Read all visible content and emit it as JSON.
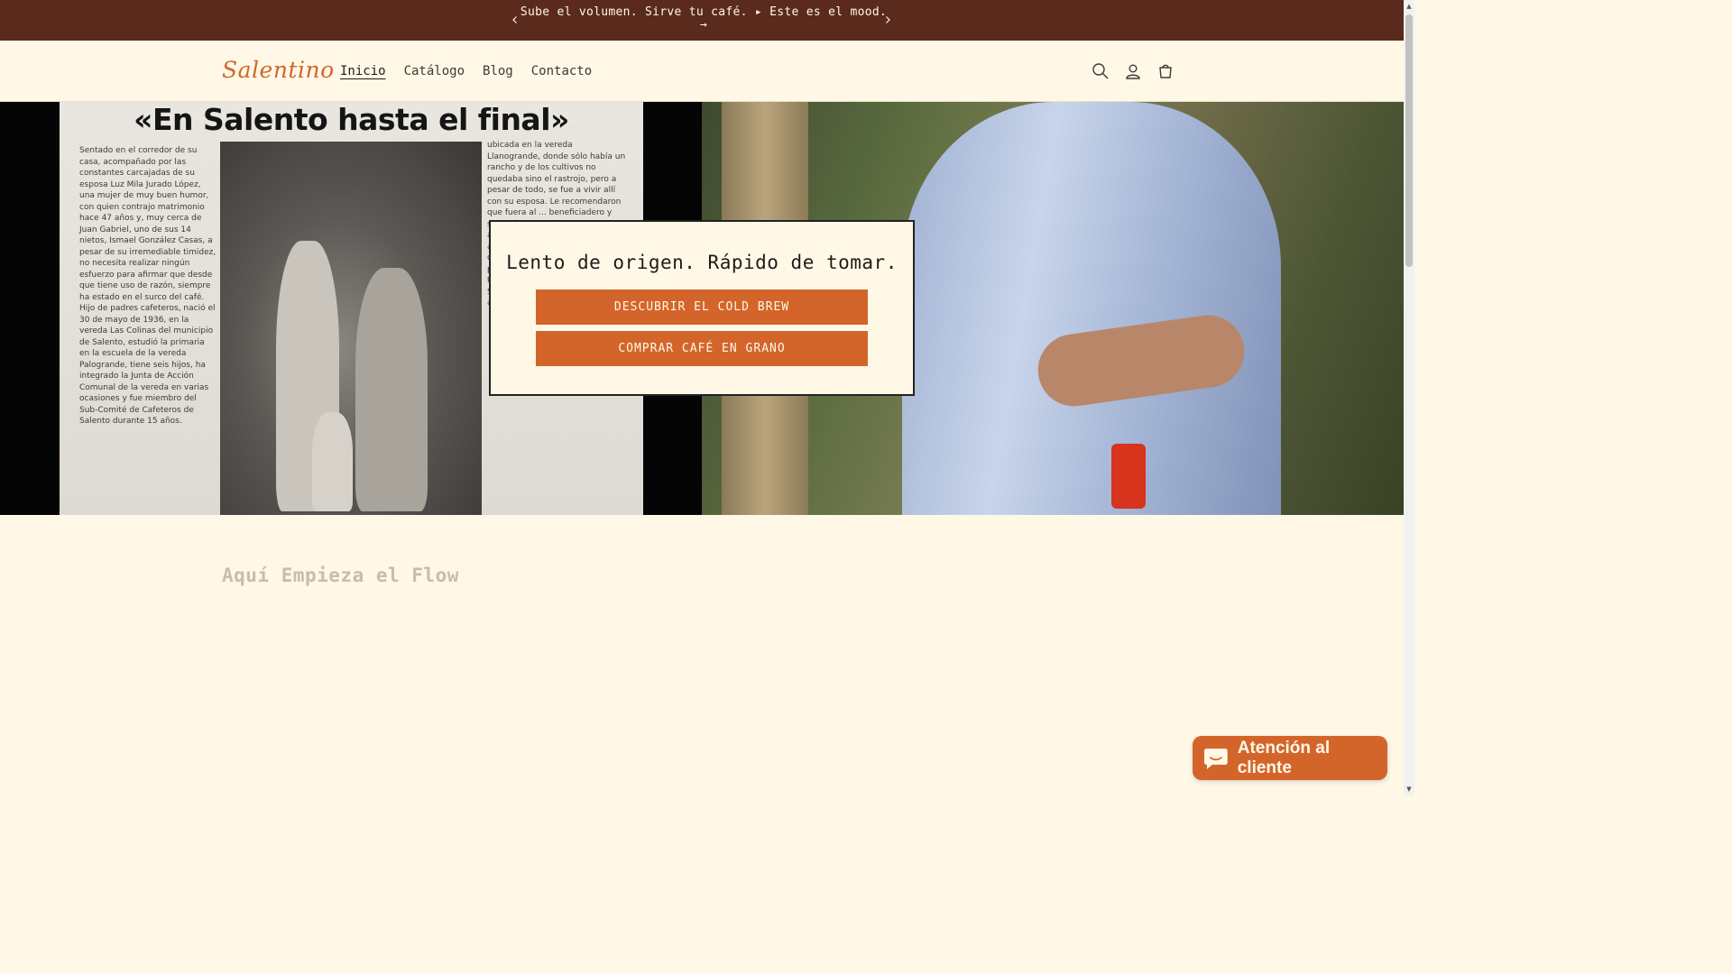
{
  "announcement": {
    "text": "Sube el volumen. Sirve tu café. ▸ Este es el mood.",
    "arrow": "→",
    "prev_icon": "chevron-left-icon",
    "next_icon": "chevron-right-icon"
  },
  "header": {
    "logo": "Salentino",
    "nav": [
      "Inicio",
      "Catálogo",
      "Blog",
      "Contacto"
    ],
    "active_nav": "Inicio",
    "icons": [
      "search-icon",
      "account-icon",
      "cart-icon"
    ]
  },
  "hero": {
    "newspaper_headline": "«En Salento hasta el final»",
    "newspaper_col1": "Sentado en el corredor de su casa, acompañado por las constantes carcajadas de su esposa Luz Mila Jurado López, una mujer de muy buen humor, con quien contrajo matrimonio hace 47 años y, muy cerca de Juan Gabriel, uno de sus 14 nietos, Ismael González Casas, a pesar de su irremediable timidez, no necesita realizar ningún esfuerzo para afirmar que desde que tiene uso de razón, siempre ha estado en el surco del café. Hijo de padres cafeteros, nació el 30 de mayo de 1936, en la vereda Las Colinas del municipio de Salento, estudió la primaria en la escuela de la vereda Palogrande, tiene seis hijos, ha integrado la Junta de Acción Comunal de la vereda en varias ocasiones y fue miembro del Sub-Comité de Cafeteros de Salento durante 15 años.",
    "newspaper_col2": "ubicada en la vereda Llanogrande, donde sólo había un rancho y de los cultivos no quedaba sino el rastrojo, pero a pesar de todo, se fue a vivir allí con su esposa. Le recomendaron que fuera al ... beneficiadero y sembró fríjol, maíz, yuca, arrachacha, mafafa y plátano; además ha tenido gallinas, patos, conejos y cerdos. Su esposa participa actualmente, en los talleres del programa de Seguridad Alimentaria que adelanta el Comité.",
    "title": "Lento de origen. Rápido de tomar.",
    "button1": "DESCUBRIR EL COLD BREW",
    "button2": "COMPRAR CAFÉ EN GRANO"
  },
  "section": {
    "title": "Aquí Empieza el Flow"
  },
  "chat": {
    "label": "Atención al cliente",
    "icon": "chat-bubble-icon"
  },
  "colors": {
    "announcement_bg": "#5a2a1c",
    "page_bg": "#fff8e7",
    "accent": "#d4652a"
  }
}
